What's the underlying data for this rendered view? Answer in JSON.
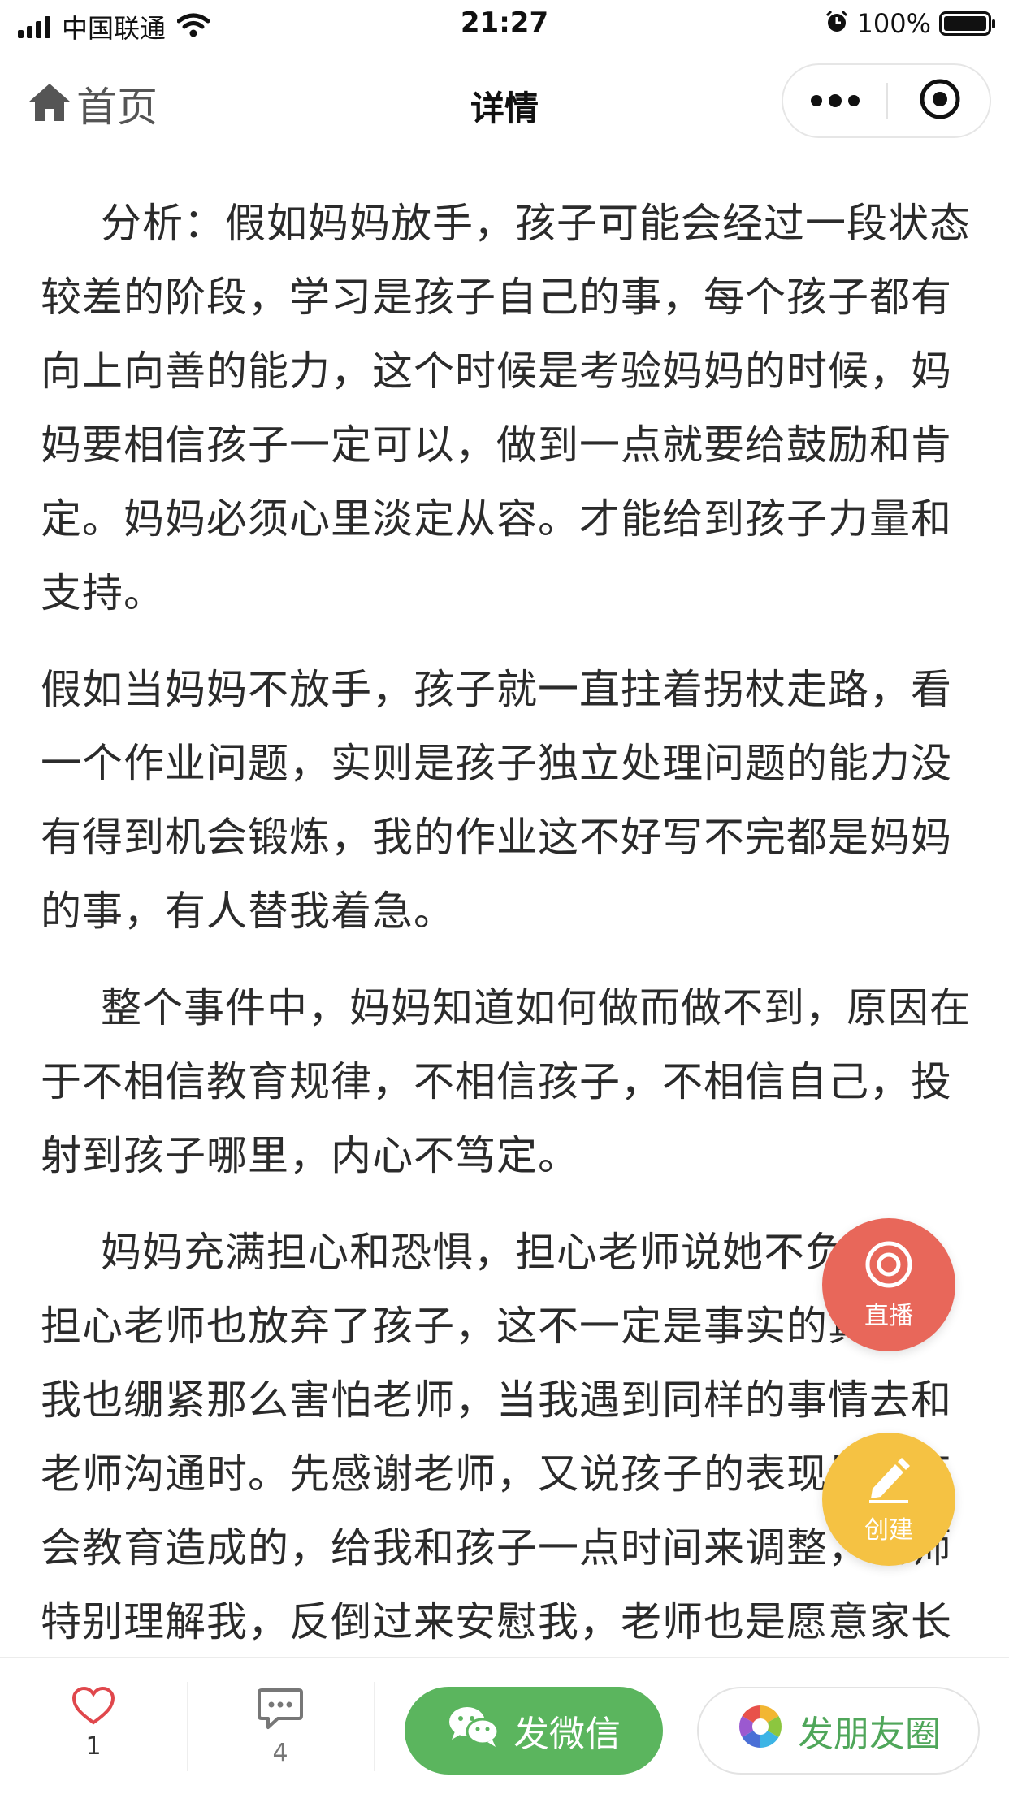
{
  "status_bar": {
    "carrier": "中国联通",
    "time": "21:27",
    "battery": "100%",
    "battery_level": 1.0
  },
  "nav": {
    "home_label": "首页",
    "title": "详情"
  },
  "article": {
    "paragraphs": [
      "分析：假如妈妈放手，孩子可能会经过一段状态较差的阶段，学习是孩子自己的事，每个孩子都有向上向善的能力，这个时候是考验妈妈的时候，妈妈要相信孩子一定可以，做到一点就要给鼓励和肯定。妈妈必须心里淡定从容。才能给到孩子力量和支持。",
      "假如当妈妈不放手，孩子就一直拄着拐杖走路，看一个作业问题，实则是孩子独立处理问题的能力没有得到机会锻炼，我的作业这不好写不完都是妈妈的事，有人替我着急。",
      "整个事件中，妈妈知道如何做而做不到，原因在于不相信教育规律，不相信孩子，不相信自己，投射到孩子哪里，内心不笃定。",
      "妈妈充满担心和恐惧，担心老师说她不负责任，担心老师也放弃了孩子，这不一定是事实的真像，我也绷紧那么害怕老师，当我遇到同样的事情去和老师沟通时。先感谢老师，又说孩子的表现是我不会教育造成的，给我和孩子一点时间来调整，老师特别理解我，反倒过来安慰我，老师也是愿意家长配合的，会支持，下面是更简单"
    ]
  },
  "floating": {
    "live_label": "直播",
    "create_label": "创建",
    "live_color": "#e8675a",
    "create_color": "#f5c243"
  },
  "bottom_bar": {
    "like_count": "1",
    "comment_count": "4",
    "wechat_label": "发微信",
    "moments_label": "发朋友圈",
    "like_color": "#e0474c",
    "wechat_color": "#5bb55e"
  }
}
